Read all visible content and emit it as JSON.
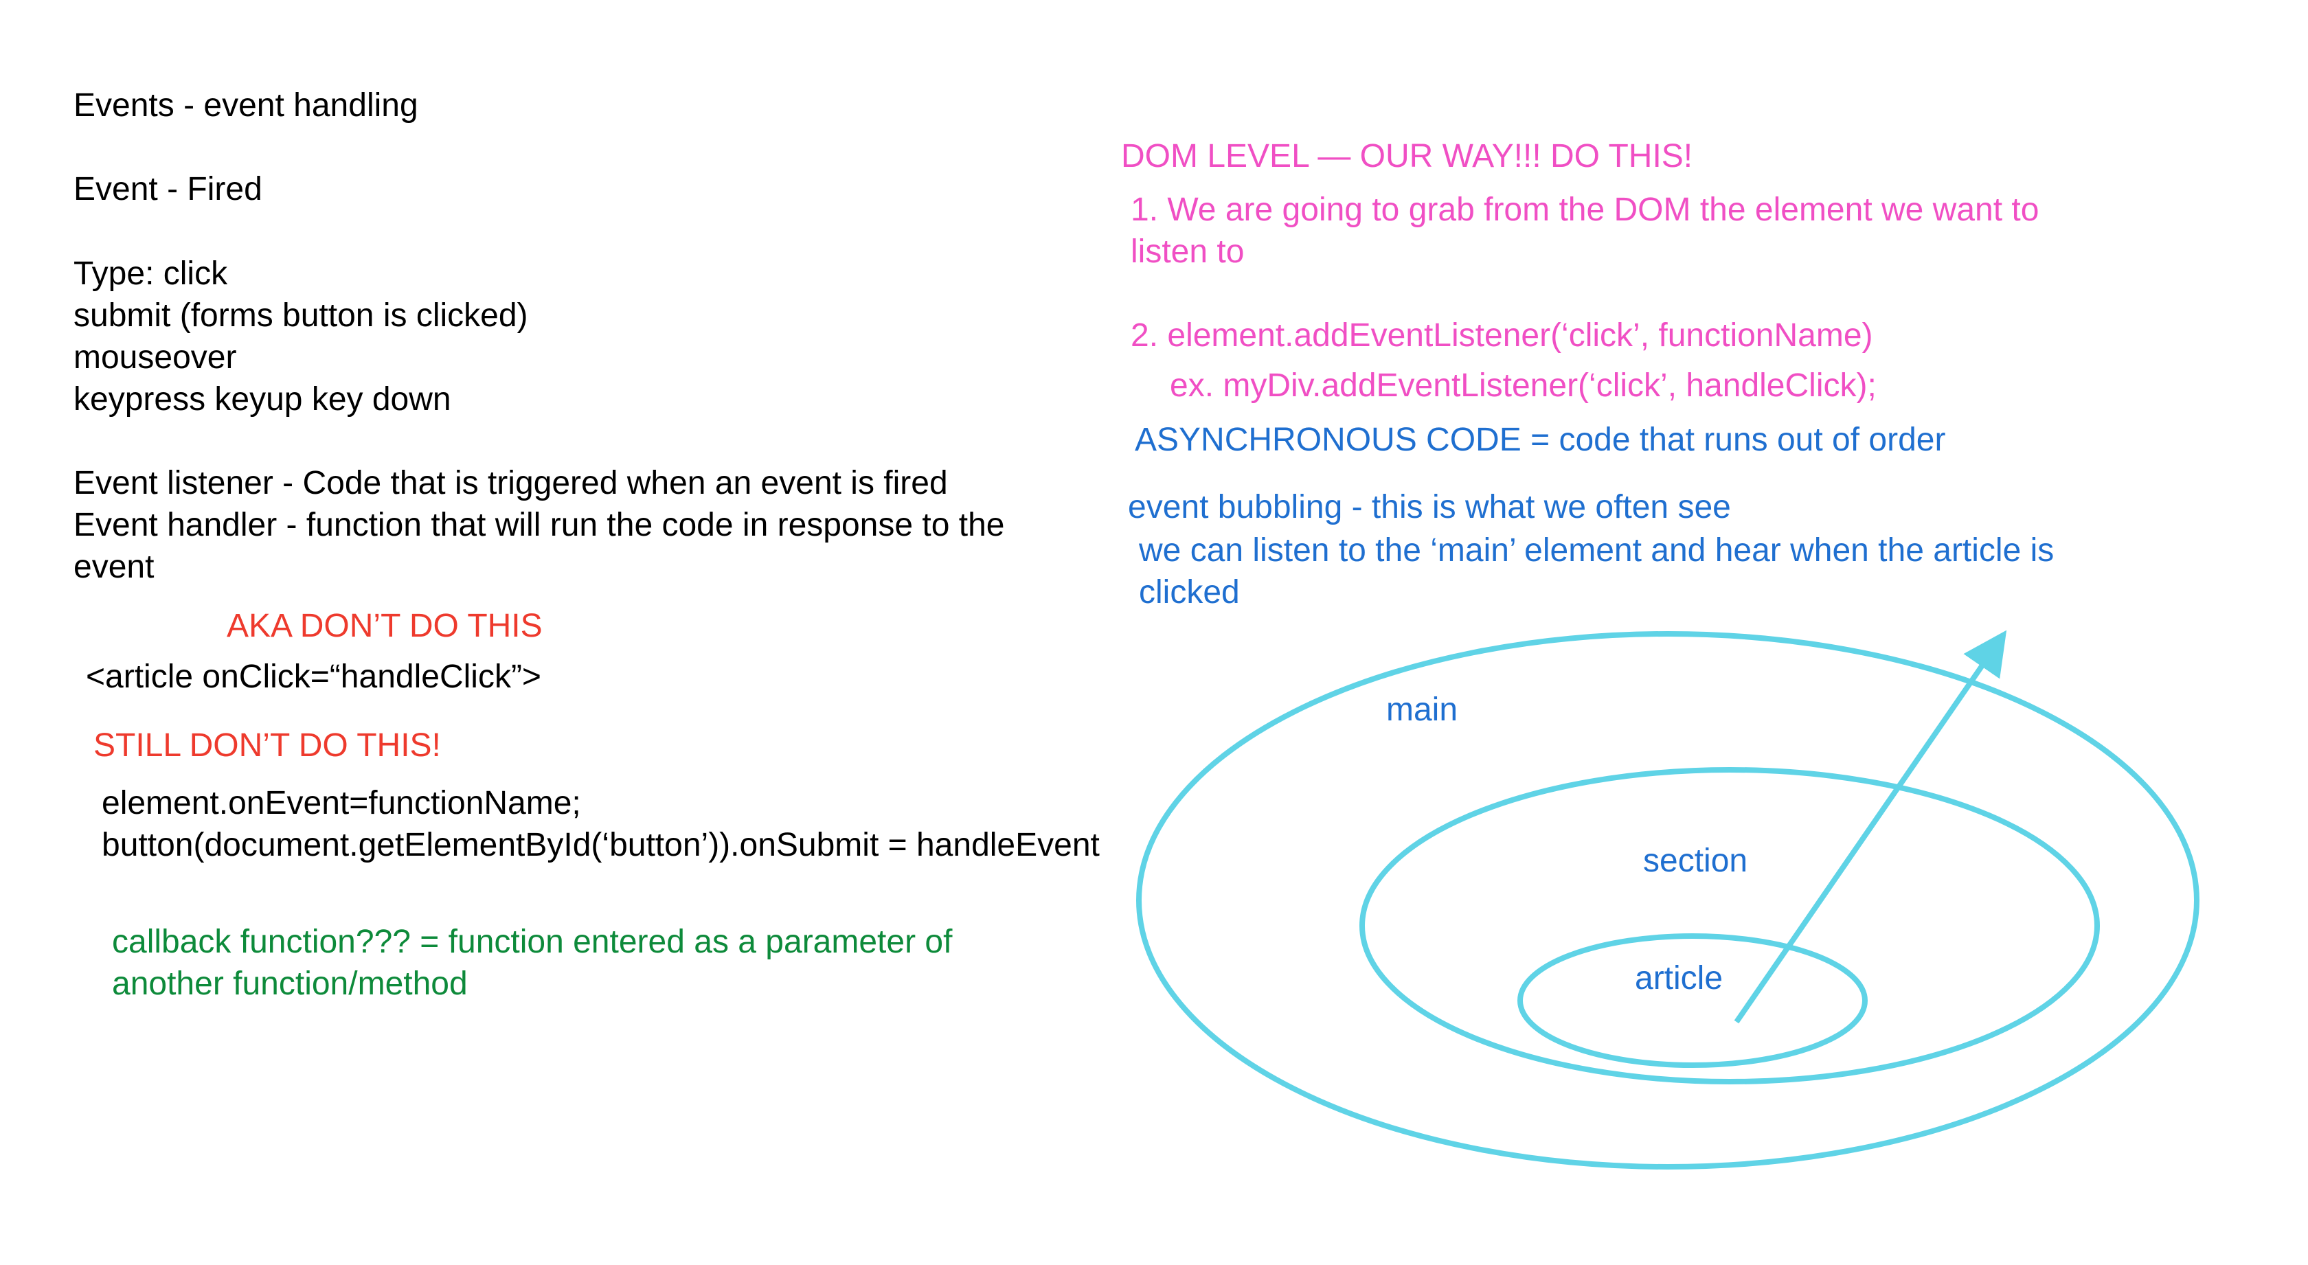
{
  "left_notes": {
    "title": "Events - event handling",
    "fired": "Event - Fired",
    "types": [
      "Type: click",
      "submit (forms button is clicked)",
      "mouseover",
      "keypress keyup key down"
    ],
    "listener": "Event listener - Code that is triggered when an event is fired",
    "handler_line1": "Event handler - function that will run the code in response to the",
    "handler_line2": "event",
    "aka_warning": "AKA DON’T DO THIS",
    "inline_example": "<article onClick=“handleClick”>",
    "still_warning": "STILL DON’T DO THIS!",
    "code_line1": "element.onEvent=functionName;",
    "code_line2": "button(document.getElementById(‘button’)).onSubmit = handleEvent",
    "callback_line1": "callback function??? = function entered as a parameter of",
    "callback_line2": "another function/method"
  },
  "right_notes": {
    "dom_level": "DOM LEVEL — OUR WAY!!! DO THIS!",
    "step1_line1": "1. We are going to grab from the DOM the element we want to",
    "step1_line2": "listen to",
    "step2": "2. element.addEventListener(‘click’, functionName)",
    "step2_example": "ex. myDiv.addEventListener(‘click’, handleClick);",
    "async": "ASYNCHRONOUS CODE = code that runs out of order",
    "bubbling": "event bubbling - this is what we often see",
    "bubbling_line2": "we can listen to the ‘main’ element and hear when the article is",
    "bubbling_line3": "clicked"
  },
  "diagram": {
    "labels": {
      "main": "main",
      "section": "section",
      "article": "article"
    },
    "ellipse_color": "#5fd3e6",
    "arrow_color": "#5fd3e6"
  },
  "colors": {
    "black": "#000000",
    "red": "#ee3a2d",
    "pink": "#f04fc4",
    "blue": "#1f6fd0",
    "green": "#0d8a3a"
  }
}
